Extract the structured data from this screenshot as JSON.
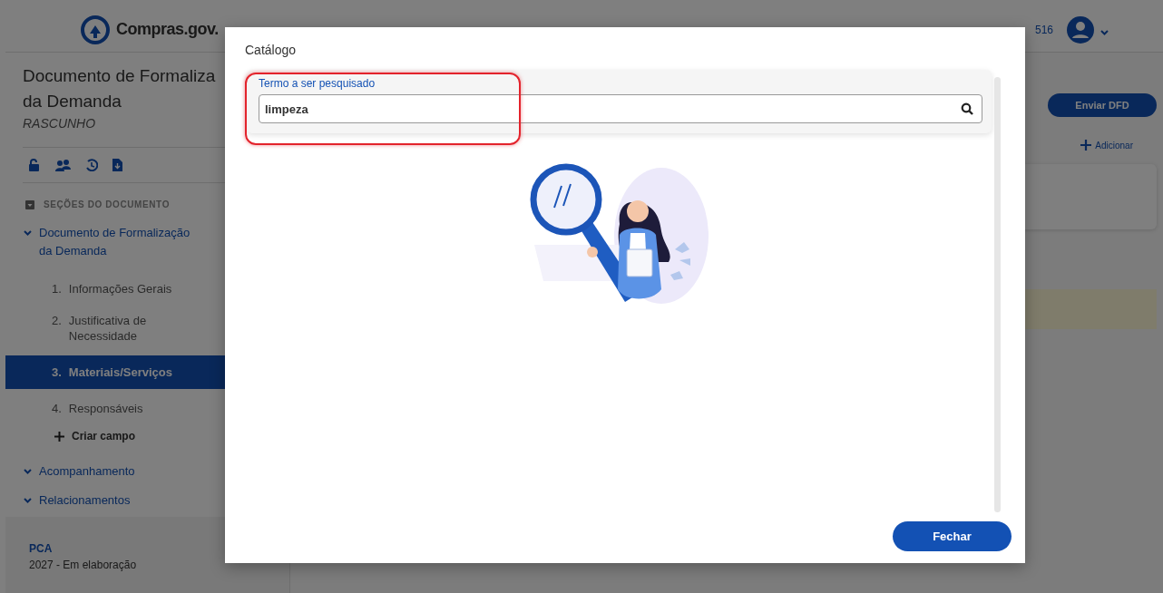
{
  "header": {
    "logo_text": "Compras.gov.",
    "org_text": "516"
  },
  "document": {
    "title_lines": [
      "Documento de Formaliza",
      "da Demanda"
    ],
    "status": "RASCUNHO"
  },
  "sections": {
    "heading": "SEÇÕES DO DOCUMENTO",
    "items": [
      {
        "label": "Documento de Formalização da Demanda",
        "children": [
          {
            "number": "1.",
            "label": "Informações Gerais",
            "selected": false
          },
          {
            "number": "2.",
            "label": "Justificativa de Necessidade",
            "selected": false
          },
          {
            "number": "3.",
            "label": "Materiais/Serviços",
            "selected": true
          },
          {
            "number": "4.",
            "label": "Responsáveis",
            "selected": false
          }
        ],
        "add_label": "Criar campo"
      },
      {
        "label": "Acompanhamento"
      },
      {
        "label": "Relacionamentos"
      }
    ]
  },
  "footer": {
    "label": "PCA",
    "value": "2027 - Em elaboração"
  },
  "main": {
    "send_button": "Enviar DFD",
    "add_button": "Adicionar"
  },
  "modal": {
    "title": "Catálogo",
    "search": {
      "label": "Termo a ser pesquisado",
      "value": "limpeza",
      "highlighted": true
    },
    "close_button": "Fechar"
  }
}
